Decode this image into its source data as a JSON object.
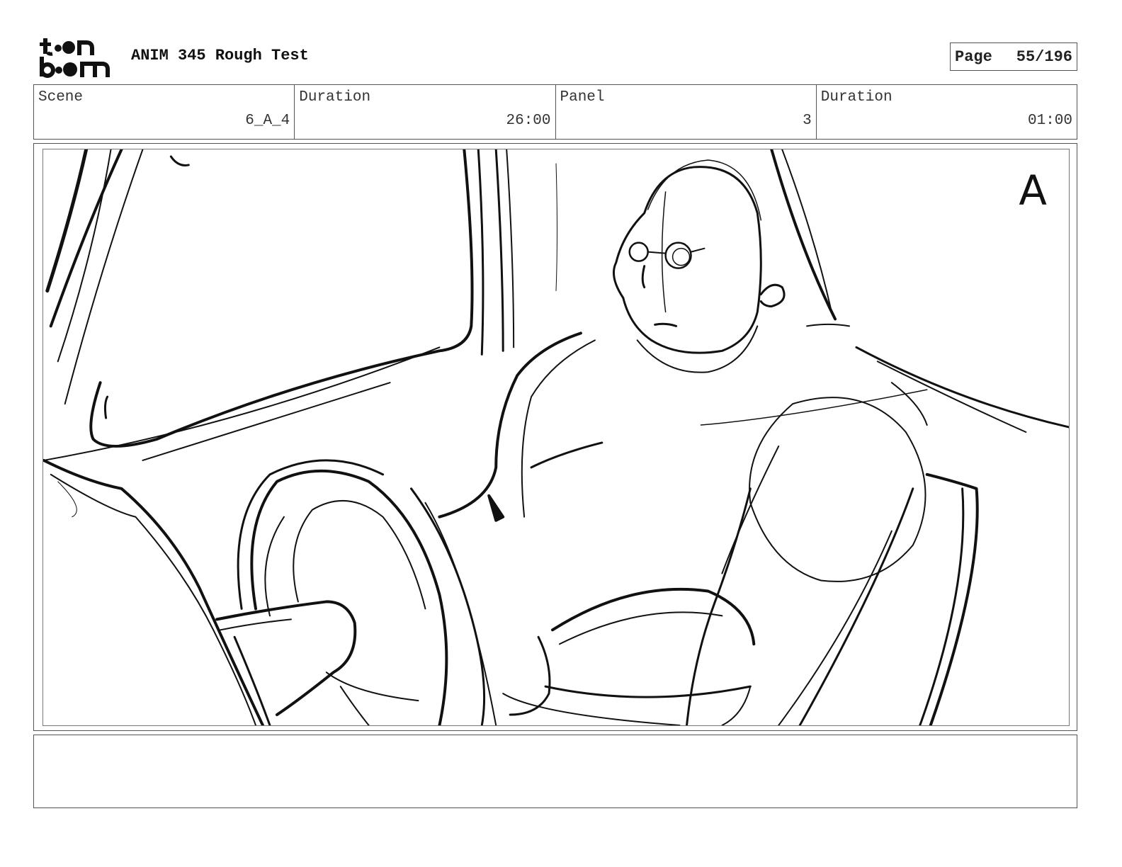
{
  "header": {
    "logo_text": "toon boom",
    "project_title": "ANIM 345 Rough Test",
    "page_label": "Page",
    "page_number": "55/196"
  },
  "info": {
    "scene_label": "Scene",
    "scene_value": "6_A_4",
    "scene_duration_label": "Duration",
    "scene_duration_value": "26:00",
    "panel_label": "Panel",
    "panel_value": "3",
    "panel_duration_label": "Duration",
    "panel_duration_value": "01:00"
  },
  "panel": {
    "corner_mark": "A",
    "drawing": "rough pencil sketch of a bald man with round glasses sitting in a vehicle seat, hand on steering wheel"
  },
  "notes": {
    "text": ""
  }
}
